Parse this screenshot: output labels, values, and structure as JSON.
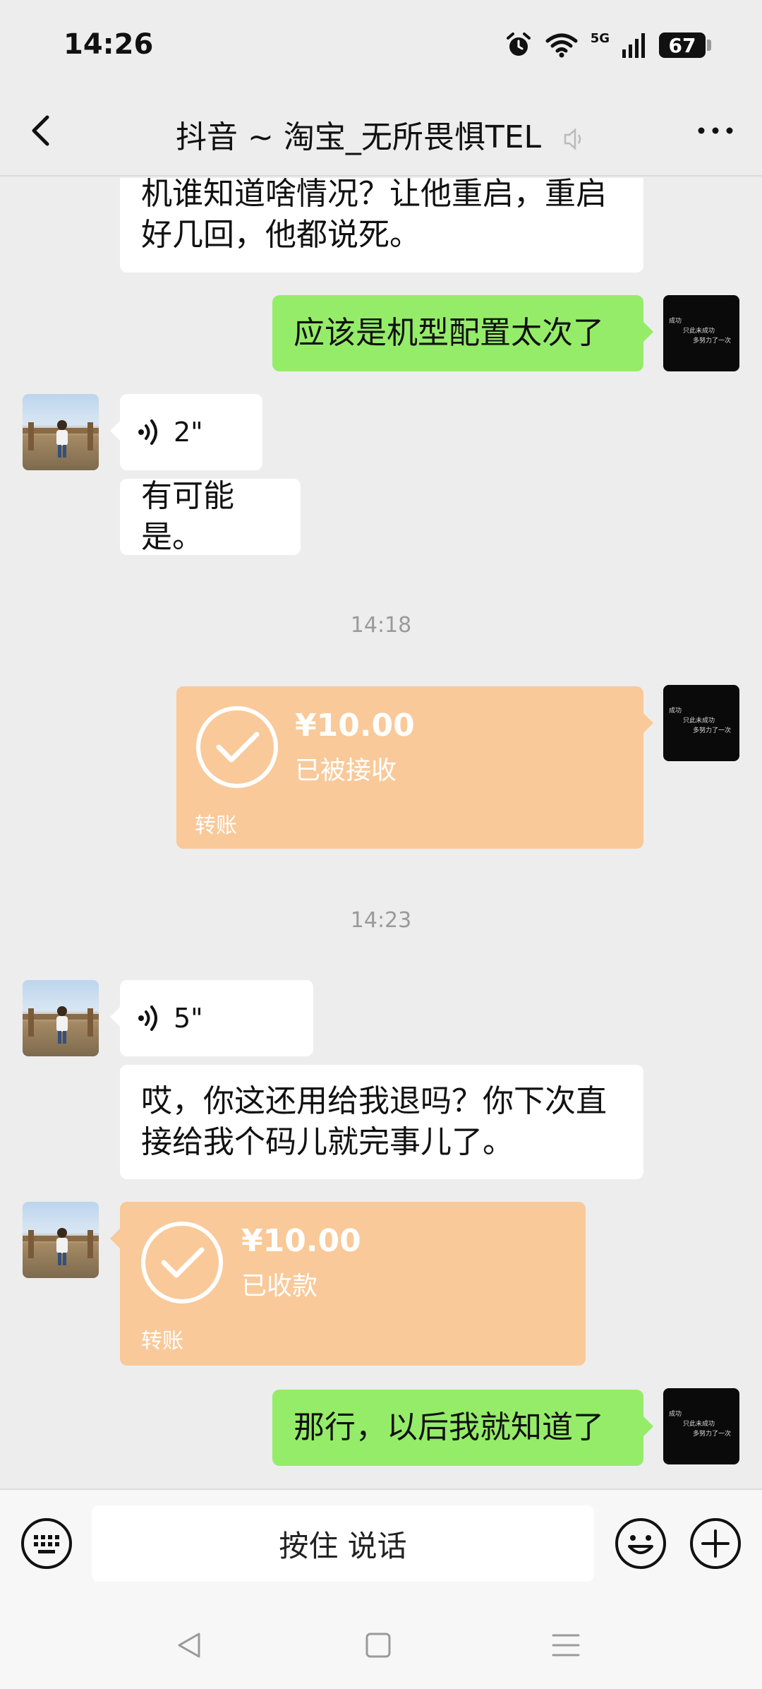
{
  "status_bar": {
    "time": "14:26",
    "battery": "67",
    "network": "5G"
  },
  "header": {
    "title": "抖音 ~ 淘宝_无所畏惧TEL"
  },
  "messages": [
    {
      "side": "in",
      "type": "text",
      "text_lines": [
        "机谁知道啥情况？让他重启，重启",
        "好几回，他都说死。"
      ]
    },
    {
      "side": "out",
      "type": "text",
      "text": "应该是机型配置太次了"
    },
    {
      "side": "in",
      "type": "voice",
      "duration": "2\""
    },
    {
      "side": "in",
      "type": "text",
      "text": "有可能是。"
    },
    {
      "type": "timestamp",
      "text": "14:18"
    },
    {
      "side": "out",
      "type": "transfer",
      "amount": "¥10.00",
      "status": "已被接收",
      "label": "转账"
    },
    {
      "type": "timestamp",
      "text": "14:23"
    },
    {
      "side": "in",
      "type": "voice",
      "duration": "5\""
    },
    {
      "side": "in",
      "type": "text",
      "text_lines": [
        "哎，你这还用给我退吗？你下次直",
        "接给我个码儿就完事儿了。"
      ]
    },
    {
      "side": "in",
      "type": "transfer",
      "amount": "¥10.00",
      "status": "已收款",
      "label": "转账"
    },
    {
      "side": "out",
      "type": "text",
      "text": "那行，以后我就知道了"
    }
  ],
  "avatar_self_text": [
    "成功",
    "只此未成功",
    "多努力了一次"
  ],
  "input_bar": {
    "hold_to_talk": "按住 说话"
  },
  "colors": {
    "background": "#ededed",
    "outgoing_bubble": "#95ec69",
    "incoming_bubble": "#ffffff",
    "transfer_card": "#f9c999"
  }
}
